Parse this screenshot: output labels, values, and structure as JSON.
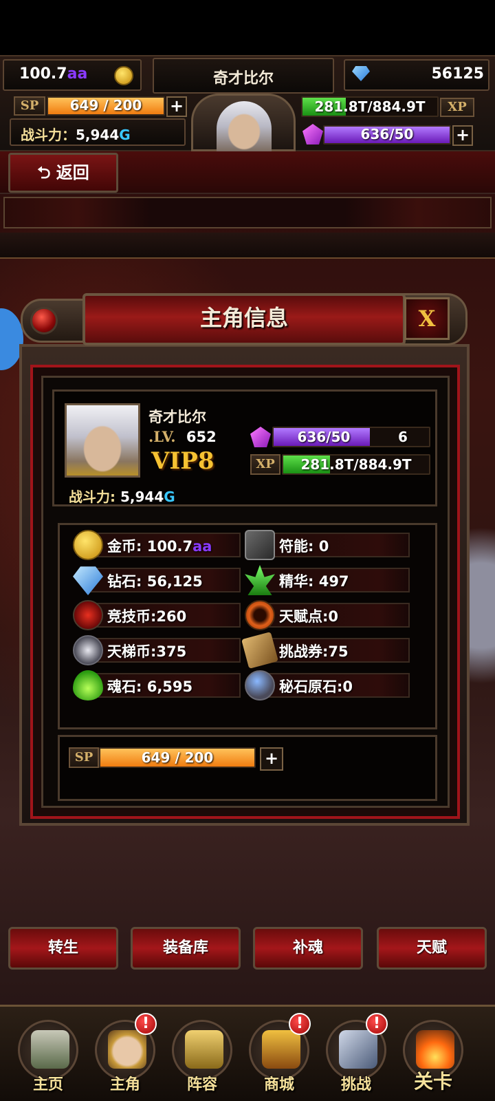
{
  "hud": {
    "gold_value": "100.7",
    "gold_suffix": "aa",
    "player_name": "奇才比尔",
    "diamond_value": "56125",
    "sp_tag": "SP",
    "sp_bar": "649 / 200",
    "sp_fill": 1.0,
    "power_label": "战斗力：",
    "power_value": "5,944",
    "power_suffix": "G",
    "xp_bar": "281.8T/884.9T",
    "xp_tag": "XP",
    "xp_fill": 0.32,
    "gem_bar": "636/50",
    "gem_fill": 1.0,
    "plus": "+"
  },
  "back_button": {
    "icon": "return-arrow-icon",
    "label": "返回"
  },
  "dialog": {
    "title": "主角信息",
    "close_label": "X",
    "hero": {
      "name": "奇才比尔",
      "lv_label": ".LV.",
      "lv_value": "652",
      "vip": "VIP8",
      "power_label": "战斗力: ",
      "power_value": "5,944",
      "power_suffix": "G",
      "gem_bar": "636/50",
      "gem_extra": "6",
      "xp_tag": "XP",
      "xp_bar": "281.8T/884.9T"
    },
    "stats_left": [
      {
        "icon": "gold-coin-icon",
        "label": "金币: 100.7",
        "suffix": "aa"
      },
      {
        "icon": "diamond-icon",
        "label": "钻石: 56,125",
        "suffix": ""
      },
      {
        "icon": "arena-coin-icon",
        "label": "竞技币:260",
        "suffix": ""
      },
      {
        "icon": "ladder-coin-icon",
        "label": "天梯币:375",
        "suffix": ""
      },
      {
        "icon": "soul-stone-icon",
        "label": "魂石: 6,595",
        "suffix": ""
      }
    ],
    "stats_right": [
      {
        "icon": "rune-icon",
        "label": "符能: 0"
      },
      {
        "icon": "essence-icon",
        "label": "精华: 497"
      },
      {
        "icon": "talent-point-icon",
        "label": "天赋点:0"
      },
      {
        "icon": "challenge-ticket-icon",
        "label": "挑战券:75"
      },
      {
        "icon": "secret-stone-icon",
        "label": "秘石原石:0"
      }
    ],
    "sp_tag": "SP",
    "sp_bar": "649 / 200",
    "plus": "+"
  },
  "actions": [
    "转生",
    "装备库",
    "补魂",
    "天赋"
  ],
  "nav": [
    {
      "label": "主页",
      "icon": "castle-icon",
      "badge": ""
    },
    {
      "label": "主角",
      "icon": "hero-icon",
      "badge": "!"
    },
    {
      "label": "阵容",
      "icon": "helmet-icon",
      "badge": ""
    },
    {
      "label": "商城",
      "icon": "treasure-chest-icon",
      "badge": "!"
    },
    {
      "label": "挑战",
      "icon": "axe-sword-icon",
      "badge": "!"
    },
    {
      "label": "关卡",
      "icon": "fire-gate-icon",
      "badge": ""
    }
  ],
  "colors": {
    "sp_orange": "#f59a1c",
    "xp_green": "#2fb82a",
    "gem_purple": "#8a3ed8",
    "accent_red": "#a0141a",
    "suffix_purple": "#8a3aff",
    "suffix_cyan": "#3ac8ff"
  }
}
